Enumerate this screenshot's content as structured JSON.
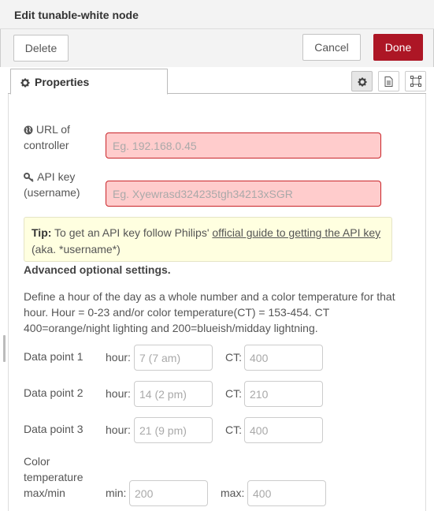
{
  "header": {
    "title": "Edit tunable-white node"
  },
  "toolbar": {
    "delete_label": "Delete",
    "cancel_label": "Cancel",
    "done_label": "Done"
  },
  "tabs": {
    "properties_label": "Properties",
    "icons": [
      "gear-icon",
      "description-icon",
      "appearance-icon"
    ]
  },
  "form": {
    "url": {
      "label_line1": "URL of",
      "label_line2": "controller",
      "placeholder": "Eg. 192.168.0.45",
      "icon": "globe-icon"
    },
    "apikey": {
      "label_line1": "API key",
      "label_line2": "(username)",
      "placeholder": "Eg. Xyewrasd324235tgh34213xSGR",
      "icon": "key-icon"
    },
    "tip": {
      "bold": "Tip:",
      "text_before": " To get an API key follow Philips' ",
      "link": "official guide to getting the API key",
      "text_after": " (aka. *username*)"
    },
    "advanced_title": "Advanced optional settings.",
    "description": "Define a hour of the day as a whole number and a color temperature for that hour. Hour = 0-23 and/or color temperature(CT) = 153-454. CT 400=orange/night lighting and 200=blueish/midday lightning.",
    "data_points": [
      {
        "label": "Data point 1",
        "hour_label": "hour:",
        "hour_placeholder": "7 (7 am)",
        "ct_label": "CT:",
        "ct_placeholder": "400"
      },
      {
        "label": "Data point 2",
        "hour_label": "hour:",
        "hour_placeholder": "14 (2 pm)",
        "ct_label": "CT:",
        "ct_placeholder": "210"
      },
      {
        "label": "Data point 3",
        "hour_label": "hour:",
        "hour_placeholder": "21 (9 pm)",
        "ct_label": "CT:",
        "ct_placeholder": "400"
      }
    ],
    "color_temp": {
      "label_line1": "Color",
      "label_line2": "temperature",
      "label_line3": "max/min",
      "min_label": "min:",
      "min_placeholder": "200",
      "max_label": "max:",
      "max_placeholder": "400"
    }
  },
  "colors": {
    "done_bg": "#ad1625",
    "error_bg": "#ffcccc",
    "error_border": "#c9252a",
    "tip_bg": "#ffffe0"
  }
}
